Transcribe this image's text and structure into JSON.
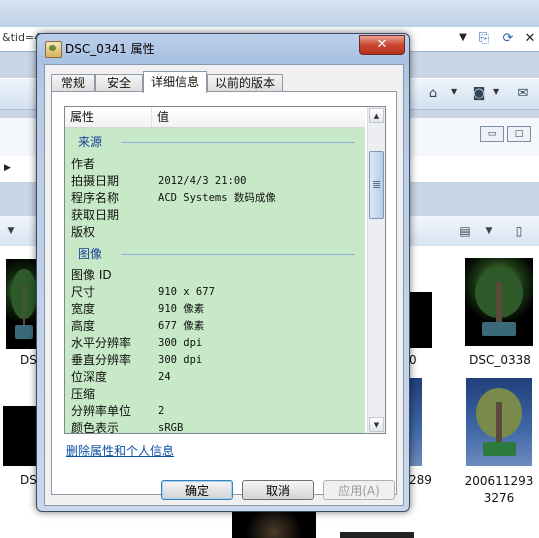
{
  "background": {
    "address_text": "&tid=4",
    "files": [
      {
        "name": "DS"
      },
      {
        "name": "0"
      },
      {
        "name": "DSC_0338"
      },
      {
        "name": "DS"
      },
      {
        "name": "289"
      },
      {
        "name": "2006112933276"
      }
    ]
  },
  "dialog": {
    "title": "DSC_0341 属性",
    "close_symbol": "✕",
    "tabs": [
      "常规",
      "安全",
      "详细信息",
      "以前的版本"
    ],
    "active_tab": "详细信息",
    "columns": {
      "property": "属性",
      "value": "值"
    },
    "groups": [
      {
        "label": "来源",
        "rows": [
          {
            "key": "作者",
            "value": ""
          },
          {
            "key": "拍摄日期",
            "value": "2012/4/3 21:00"
          },
          {
            "key": "程序名称",
            "value": "ACD Systems 数码成像"
          },
          {
            "key": "获取日期",
            "value": ""
          },
          {
            "key": "版权",
            "value": ""
          }
        ]
      },
      {
        "label": "图像",
        "rows": [
          {
            "key": "图像 ID",
            "value": ""
          },
          {
            "key": "尺寸",
            "value": "910 x 677"
          },
          {
            "key": "宽度",
            "value": "910 像素"
          },
          {
            "key": "高度",
            "value": "677 像素"
          },
          {
            "key": "水平分辨率",
            "value": "300 dpi"
          },
          {
            "key": "垂直分辨率",
            "value": "300 dpi"
          },
          {
            "key": "位深度",
            "value": "24"
          },
          {
            "key": "压缩",
            "value": ""
          },
          {
            "key": "分辨率单位",
            "value": "2"
          },
          {
            "key": "颜色表示",
            "value": "sRGB"
          }
        ]
      }
    ],
    "remove_link": "删除属性和个人信息",
    "buttons": {
      "ok": "确定",
      "cancel": "取消",
      "apply": "应用(A)"
    },
    "colors": {
      "list_background": "#c7e9c7",
      "group_label": "#1e3f9a",
      "link": "#0b4ea5"
    }
  }
}
